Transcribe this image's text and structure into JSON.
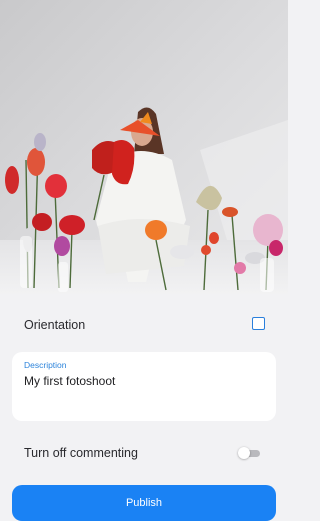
{
  "orientation": {
    "label": "Orientation",
    "checked": false
  },
  "description": {
    "label": "Description",
    "value": "My first fotoshoot"
  },
  "commenting": {
    "label": "Turn off commenting",
    "enabled": false
  },
  "publish": {
    "label": "Publish"
  },
  "colors": {
    "accent": "#1a82f4",
    "label_blue": "#2d84db",
    "background": "#f2f2f4"
  }
}
